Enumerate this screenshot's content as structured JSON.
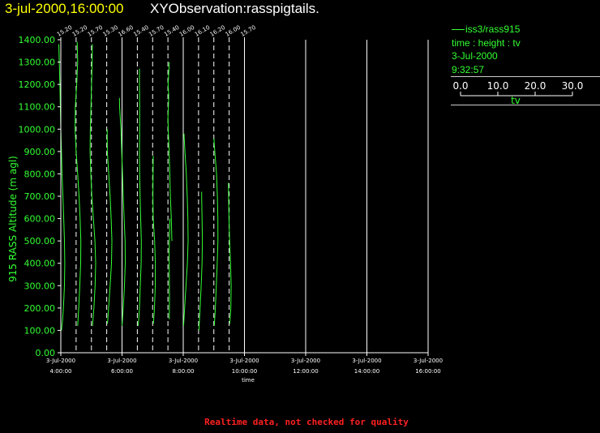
{
  "header": {
    "datetime": "3-jul-2000,16:00:00",
    "title": "XYObservation:rasspigtails."
  },
  "legend": {
    "series_label": "iss3/rass915",
    "axes": "time : height : tv",
    "date": "3-Jul-2000",
    "time": "9:32:57",
    "scale_ticks": [
      "0.0",
      "10.0",
      "20.0",
      "30.0"
    ],
    "scale_label": "tv"
  },
  "footer": {
    "text": "Realtime data, not checked for quality"
  },
  "colors": {
    "background": "#000000",
    "axis": "#ffffff",
    "data": "#33ff33",
    "title_date": "#ffff00",
    "footer": "#ff2020"
  },
  "chart_data": {
    "type": "line",
    "ylabel": "915 RASS Altitude (m agl)",
    "xlabel": "time",
    "ylim": [
      0,
      1400
    ],
    "yticks": [
      "0.00",
      "100.00",
      "200.00",
      "300.00",
      "400.00",
      "500.00",
      "600.00",
      "700.00",
      "800.00",
      "900.00",
      "1000.00",
      "1100.00",
      "1200.00",
      "1300.00",
      "1400.00"
    ],
    "xlim": [
      "3-Jul-2000 04:00",
      "3-Jul-2000 16:00"
    ],
    "xticks": [
      {
        "date": "3-Jul-2000",
        "time": "4:00:00"
      },
      {
        "date": "3-Jul-2000",
        "time": "6:00:00"
      },
      {
        "date": "3-Jul-2000",
        "time": "8:00:00"
      },
      {
        "date": "3-Jul-2000",
        "time": "10:00:00"
      },
      {
        "date": "3-Jul-2000",
        "time": "12:00:00"
      },
      {
        "date": "3-Jul-2000",
        "time": "14:00:00"
      },
      {
        "date": "3-Jul-2000",
        "time": "16:00:00"
      }
    ],
    "grid": true,
    "pigtail_units_per_hour": 20,
    "profiles": [
      {
        "time": "04:00",
        "base": "15.20",
        "points": [
          [
            100,
            15.6
          ],
          [
            150,
            16.4
          ],
          [
            200,
            16.9
          ],
          [
            300,
            17.6
          ],
          [
            400,
            17.8
          ],
          [
            500,
            17.6
          ],
          [
            600,
            17.1
          ],
          [
            700,
            16.6
          ],
          [
            800,
            16.0
          ],
          [
            900,
            15.6
          ],
          [
            1000,
            15.2
          ],
          [
            1100,
            14.9
          ],
          [
            1200,
            14.6
          ],
          [
            1300,
            14.2
          ],
          [
            1380,
            13.9
          ]
        ]
      },
      {
        "time": "04:30",
        "base": "15.20",
        "points": [
          [
            120,
            16.2
          ],
          [
            200,
            16.9
          ],
          [
            300,
            17.6
          ],
          [
            400,
            18.2
          ],
          [
            500,
            18.3
          ],
          [
            600,
            17.8
          ],
          [
            700,
            17.1
          ],
          [
            800,
            16.2
          ],
          [
            900,
            15.2
          ],
          [
            1000,
            14.5
          ],
          [
            1100,
            14.7
          ],
          [
            1200,
            15.6
          ],
          [
            1300,
            16.2
          ],
          [
            1390,
            15.9
          ]
        ]
      },
      {
        "time": "05:00",
        "base": "15.70",
        "points": [
          [
            120,
            16.4
          ],
          [
            200,
            17.3
          ],
          [
            300,
            18.1
          ],
          [
            400,
            18.5
          ],
          [
            500,
            18.0
          ],
          [
            600,
            17.0
          ],
          [
            700,
            16.0
          ],
          [
            800,
            15.3
          ],
          [
            900,
            14.8
          ],
          [
            1000,
            15.0
          ],
          [
            1100,
            15.4
          ],
          [
            1200,
            15.8
          ],
          [
            1300,
            16.2
          ],
          [
            1380,
            16.3
          ]
        ]
      },
      {
        "time": "05:30",
        "base": "15.30",
        "points": [
          [
            130,
            15.8
          ],
          [
            200,
            16.5
          ],
          [
            300,
            17.5
          ],
          [
            400,
            18.4
          ],
          [
            500,
            18.7
          ],
          [
            600,
            18.2
          ],
          [
            700,
            17.5
          ],
          [
            800,
            16.6
          ],
          [
            900,
            15.7
          ],
          [
            1000,
            15.6
          ]
        ]
      },
      {
        "time": "06:00",
        "base": "16.60",
        "points": [
          [
            120,
            16.6
          ],
          [
            200,
            17.4
          ],
          [
            300,
            18.2
          ],
          [
            400,
            18.7
          ],
          [
            500,
            18.6
          ],
          [
            600,
            18.0
          ],
          [
            700,
            17.4
          ],
          [
            800,
            16.9
          ],
          [
            900,
            16.4
          ],
          [
            1000,
            15.9
          ],
          [
            1100,
            15.0
          ],
          [
            1140,
            14.9
          ]
        ]
      },
      {
        "time": "06:30",
        "base": "15.40",
        "points": [
          [
            120,
            16.0
          ],
          [
            200,
            16.8
          ],
          [
            300,
            17.3
          ],
          [
            400,
            17.9
          ],
          [
            500,
            18.0
          ],
          [
            600,
            17.6
          ],
          [
            700,
            17.2
          ],
          [
            800,
            16.9
          ],
          [
            900,
            16.8
          ],
          [
            1000,
            16.9
          ],
          [
            1100,
            16.9
          ],
          [
            1200,
            16.8
          ],
          [
            1270,
            16.8
          ]
        ]
      },
      {
        "time": "07:00",
        "base": "15.70",
        "points": [
          [
            130,
            16.2
          ],
          [
            200,
            16.9
          ],
          [
            300,
            17.4
          ],
          [
            400,
            17.5
          ],
          [
            500,
            17.0
          ],
          [
            600,
            16.1
          ],
          [
            700,
            15.9
          ],
          [
            800,
            16.0
          ],
          [
            880,
            16.1
          ]
        ]
      },
      {
        "time": "07:30",
        "base": "15.40",
        "points": [
          [
            150,
            16.3
          ],
          [
            250,
            16.4
          ],
          [
            350,
            16.3
          ],
          [
            450,
            16.2
          ],
          [
            550,
            16.5
          ],
          [
            600,
            16.7
          ]
        ]
      },
      {
        "time": "07:30",
        "base": "15.40",
        "points": [
          [
            500,
            18.0
          ],
          [
            600,
            17.6
          ],
          [
            700,
            17.0
          ],
          [
            800,
            16.6
          ],
          [
            900,
            16.2
          ],
          [
            1000,
            15.6
          ],
          [
            1050,
            15.4
          ],
          [
            1100,
            15.7
          ],
          [
            1150,
            15.9
          ],
          [
            1200,
            15.5
          ],
          [
            1250,
            15.9
          ],
          [
            1300,
            16.3
          ]
        ]
      },
      {
        "time": "08:00",
        "base": "16.10",
        "points": [
          [
            120,
            16.3
          ],
          [
            200,
            17.0
          ],
          [
            300,
            17.9
          ],
          [
            400,
            18.8
          ],
          [
            500,
            19.3
          ],
          [
            600,
            19.1
          ],
          [
            700,
            18.7
          ],
          [
            800,
            18.1
          ],
          [
            900,
            17.2
          ],
          [
            980,
            16.6
          ]
        ]
      },
      {
        "time": "08:30",
        "base": "16.20",
        "points": [
          [
            100,
            16.4
          ],
          [
            200,
            17.2
          ],
          [
            300,
            17.9
          ],
          [
            400,
            18.5
          ],
          [
            500,
            18.7
          ],
          [
            600,
            18.5
          ],
          [
            700,
            18.2
          ],
          [
            720,
            18.2
          ]
        ]
      },
      {
        "time": "09:00",
        "base": "16.00",
        "points": [
          [
            120,
            16.3
          ],
          [
            200,
            17.0
          ],
          [
            300,
            17.6
          ],
          [
            400,
            18.2
          ],
          [
            500,
            18.7
          ],
          [
            600,
            18.6
          ],
          [
            700,
            18.3
          ],
          [
            800,
            17.8
          ],
          [
            900,
            16.6
          ],
          [
            960,
            16.0
          ]
        ]
      },
      {
        "time": "09:30",
        "base": "15.70",
        "points": [
          [
            130,
            16.1
          ],
          [
            200,
            16.8
          ],
          [
            300,
            17.0
          ],
          [
            400,
            16.6
          ],
          [
            500,
            16.0
          ],
          [
            600,
            15.6
          ],
          [
            700,
            15.3
          ],
          [
            760,
            15.2
          ]
        ]
      }
    ],
    "base_labels": [
      "15.20",
      "15.20",
      "15.70",
      "15.30",
      "16.60",
      "15.40",
      "15.70",
      "15.40",
      "16.00",
      "16.10",
      "16.20",
      "16.00",
      "15.70"
    ],
    "base_label_times": [
      "04:00",
      "04:30",
      "05:00",
      "05:30",
      "06:00",
      "06:30",
      "07:00",
      "07:30",
      "08:00",
      "08:30",
      "09:00",
      "09:30",
      "10:00"
    ]
  }
}
